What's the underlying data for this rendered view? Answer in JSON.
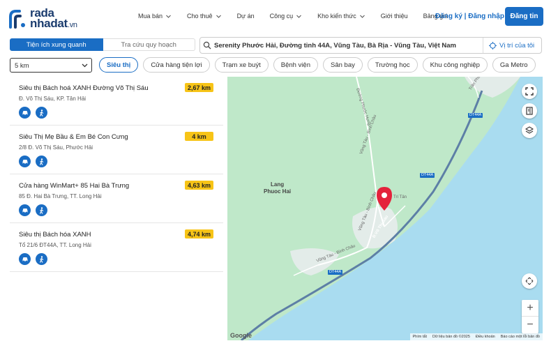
{
  "brand": {
    "logo_line1": "rada",
    "logo_line2": "nhadat",
    "logo_suffix": ".vn",
    "accent_color": "#1a6dc4",
    "distance_badge_color": "#f7c417"
  },
  "nav": {
    "items": [
      {
        "label": "Mua bán",
        "has_dropdown": true
      },
      {
        "label": "Cho thuê",
        "has_dropdown": true
      },
      {
        "label": "Dự án",
        "has_dropdown": false
      },
      {
        "label": "Công cụ",
        "has_dropdown": true
      },
      {
        "label": "Kho kiến thức",
        "has_dropdown": true
      },
      {
        "label": "Giới thiệu",
        "has_dropdown": false
      },
      {
        "label": "Bảng giá",
        "has_dropdown": false
      }
    ],
    "auth_label": "Đăng ký | Đăng nhập",
    "cta_label": "Đăng tin"
  },
  "tabs": {
    "active": "Tiện ích xung quanh",
    "inactive": "Tra cứu quy hoạch"
  },
  "search": {
    "value": "Serenity Phước Hải, Đường tỉnh 44A, Vũng Tàu, Bà Rịa - Vũng Tàu, Việt Nam",
    "locate_label": "Vị trí của tôi"
  },
  "filters": {
    "radius": "5 km",
    "categories": [
      {
        "label": "Siêu thị",
        "active": true
      },
      {
        "label": "Cửa hàng tiện lợi",
        "active": false
      },
      {
        "label": "Trạm xe buýt",
        "active": false
      },
      {
        "label": "Bệnh viện",
        "active": false
      },
      {
        "label": "Sân bay",
        "active": false
      },
      {
        "label": "Trường học",
        "active": false
      },
      {
        "label": "Khu công nghiệp",
        "active": false
      },
      {
        "label": "Ga Metro",
        "active": false
      }
    ]
  },
  "results": [
    {
      "name": "Siêu thị Bách hoá XANH Đường Võ Thị Sáu",
      "address": "Đ. Võ Thị Sáu, KP. Tân Hải",
      "distance": "2,67 km"
    },
    {
      "name": "Siêu Thị Mẹ Bầu & Em Bé Con Cưng",
      "address": "2/8 Đ. Võ Thị Sáu, Phước Hải",
      "distance": "4 km"
    },
    {
      "name": "Cửa hàng WinMart+ 85 Hai Bà Trưng",
      "address": "85 Đ. Hai Bà Trưng, TT. Long Hải",
      "distance": "4,63 km"
    },
    {
      "name": "Siêu thị Bách hóa XANH",
      "address": "Tổ 21/6 ĐT44A, TT. Long Hải",
      "distance": "4,74 km"
    }
  ],
  "map": {
    "place_label": "Lang\nPhuoc Hai",
    "road_labels": [
      "Vũng Tàu - Bình Châu",
      "Vũng Tàu - Bình Châu",
      "Vũng Tàu - Bình Châu",
      "Đ.Võ Thị Sáu",
      "Trần Phú",
      "Đường Phước Hưng",
      "Trí Tân"
    ],
    "highway_label": "DT44A",
    "google_label": "Google",
    "attribution": [
      "Phím tắt",
      "Dữ liệu bản đồ ©2025",
      "Điều khoản",
      "Báo cáo một lỗi bản đồ"
    ],
    "zoom_in": "+",
    "zoom_out": "−",
    "land_color": "#bfe8c9",
    "water_color": "#a9dcf0"
  }
}
